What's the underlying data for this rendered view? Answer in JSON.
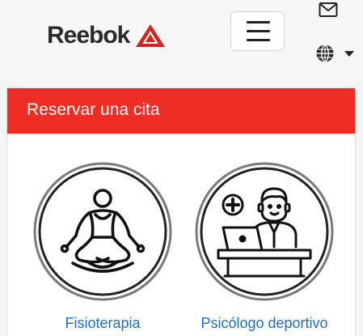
{
  "brand": {
    "name": "Reebok",
    "color": "#ee2e24"
  },
  "header": {
    "menu_icon": "hamburger-menu-icon",
    "mail_icon": "envelope-icon",
    "language_icon": "globe-icon",
    "language_caret": "caret-down-icon"
  },
  "card": {
    "title": "Reservar una cita",
    "header_color": "#ee2e24",
    "options": [
      {
        "label": "Fisioterapia",
        "icon": "yoga-meditation-icon"
      },
      {
        "label": "Psicólogo deportivo",
        "icon": "doctor-at-desk-icon"
      }
    ]
  },
  "colors": {
    "link": "#1e6fc4",
    "icon_stroke": "#222222"
  }
}
